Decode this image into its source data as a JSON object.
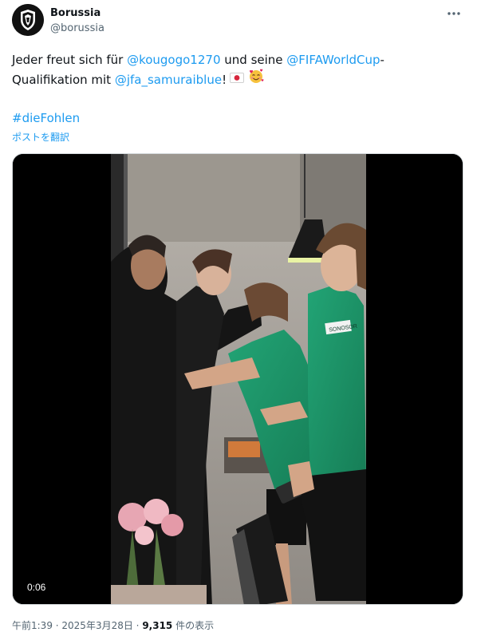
{
  "author": {
    "display_name": "Borussia",
    "handle": "@borussia"
  },
  "tweet": {
    "line1": {
      "t1": "Jeder freut sich für ",
      "m1": "@kougogo1270",
      "t2": " und seine ",
      "m2": "@FIFAWorldCup",
      "t3": "-"
    },
    "line2": {
      "t1": "Qualifikation mit ",
      "m1": "@jfa_samuraiblue",
      "t2": "!"
    },
    "emojis": [
      "flag-japan",
      "smiling-face-with-hearts"
    ],
    "hashtag": "#dieFohlen",
    "translate_label": "ポストを翻訳"
  },
  "media": {
    "type": "video",
    "duration": "0:06",
    "jersey_text": "SONOSOR"
  },
  "meta": {
    "time": "午前1:39",
    "separator": " · ",
    "date": "2025年3月28日",
    "views_count": "9,315",
    "views_label": " 件の表示"
  },
  "icons": {
    "avatar": "borussia-crest-icon",
    "more": "more-options-icon"
  },
  "colors": {
    "link": "#1d9bf0",
    "text": "#0f1419",
    "secondary": "#536471",
    "jersey": "#1f9a6b"
  }
}
